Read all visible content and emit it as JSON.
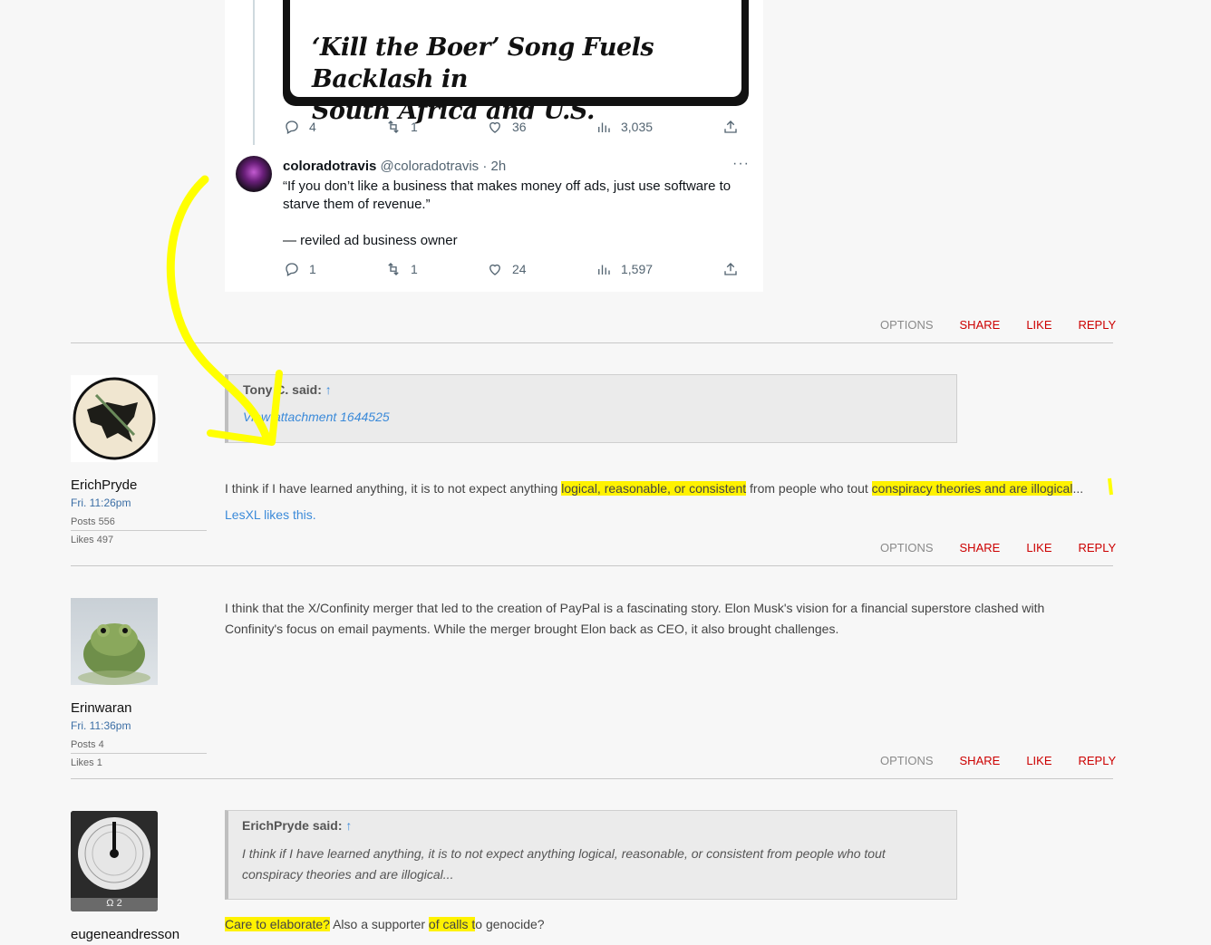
{
  "tweet1": {
    "headline_line1": "‘Kill the Boer’ Song Fuels Backlash in",
    "headline_line2": "South Africa and U.S.",
    "replies": "4",
    "retweets": "1",
    "likes": "36",
    "views": "3,035"
  },
  "tweet2": {
    "name": "coloradotravis",
    "handle": "@coloradotravis · 2h",
    "more": "···",
    "line1": "“If you don’t like a business that makes money off ads, just use software to",
    "line2": "starve them of revenue.”",
    "line3": "— reviled ad business owner",
    "replies": "1",
    "retweets": "1",
    "likes": "24",
    "views": "1,597"
  },
  "actions": {
    "options": "OPTIONS",
    "share": "SHARE",
    "like": "LIKE",
    "reply": "REPLY"
  },
  "post1": {
    "user": "ErichPryde",
    "time": "Fri. 11:26pm",
    "posts": "Posts 556",
    "likes": "Likes 497",
    "quote_author": "Tony C. said:",
    "quote_arrow": "↑",
    "quote_link": "View attachment 1644525",
    "text_a": "I think if I have learned anything, it is to not expect anything ",
    "text_hl1": "logical, reasonable, or consistent",
    "text_b": " from people who tout ",
    "text_hl2": "conspiracy theories and are illogical",
    "text_c": "...",
    "likes_user": "LesXL",
    "likes_suffix": " likes this."
  },
  "post2": {
    "user": "Erinwaran",
    "time": "Fri. 11:36pm",
    "posts": "Posts 4",
    "likes": "Likes 1",
    "line1": "I think that the X/Confinity merger that led to the creation of PayPal is a fascinating story. Elon Musk's vision for a financial superstore clashed with",
    "line2": "Confinity's focus on email payments. While the merger brought Elon back as CEO, it also brought challenges."
  },
  "post3": {
    "user": "eugeneandresson",
    "avatar_badge": "Ω 2",
    "quote_author": "ErichPryde said:",
    "quote_arrow": "↑",
    "quote_line1": "I think if I have learned anything, it is to not expect anything logical, reasonable, or consistent from people who tout",
    "quote_line2": "conspiracy theories and are illogical...",
    "hl1": "Care to elaborate?",
    "text_a": " Also a supporter ",
    "hl2": "of calls t",
    "text_b": "o genocide?"
  },
  "colors": {
    "highlight": "#fff200",
    "action_red": "#cc0000",
    "link": "#3b8ad9"
  }
}
